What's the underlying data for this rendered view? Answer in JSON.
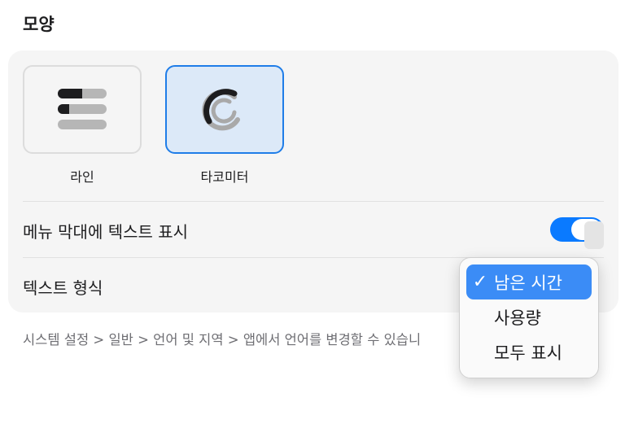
{
  "section_title": "모양",
  "styles": [
    {
      "label": "라인",
      "icon": "line-bars-icon",
      "selected": false
    },
    {
      "label": "타코미터",
      "icon": "tachometer-icon",
      "selected": true
    }
  ],
  "settings": {
    "show_text_label": "메뉴 막대에 텍스트 표시",
    "show_text_enabled": true,
    "text_format_label": "텍스트 형식"
  },
  "footnote": "시스템 설정 > 일반 > 언어 및 지역 > 앱에서 언어를 변경할 수 있습니",
  "dropdown": {
    "options": [
      "남은 시간",
      "사용량",
      "모두 표시"
    ],
    "selected": "남은 시간",
    "check_mark": "✓"
  },
  "colors": {
    "accent": "#0a7aff",
    "selected_tile_bg": "#dce9f8",
    "selected_item_bg": "#3b8cf6"
  }
}
